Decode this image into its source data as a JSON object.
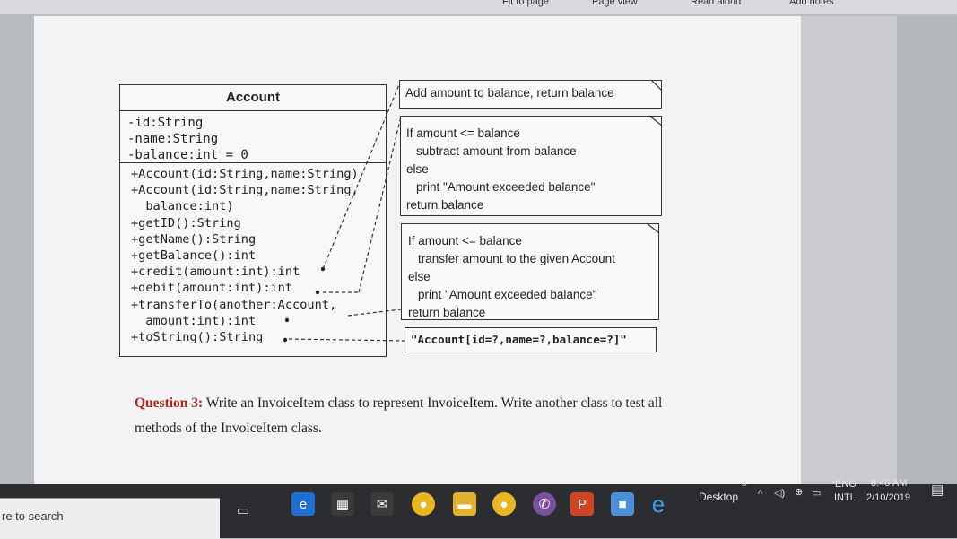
{
  "ribbon": {
    "item1": "Fit to page",
    "item2": "Page view",
    "item3": "Read aloud",
    "item4": "Add notes"
  },
  "uml": {
    "class_name": "Account",
    "attributes": [
      "-id:String",
      "-name:String",
      "-balance:int = 0"
    ],
    "operations": [
      "+Account(id:String,name:String)",
      "+Account(id:String,name:String,",
      "  balance:int)",
      "+getID():String",
      "+getName():String",
      "+getBalance():int",
      "+credit(amount:int):int",
      "+debit(amount:int):int",
      "+transferTo(another:Account,",
      "  amount:int):int",
      "+toString():String"
    ]
  },
  "notes": {
    "credit": "Add amount to balance, return balance",
    "debit": [
      "If amount <= balance",
      "subtract amount from balance",
      "else",
      "print \"Amount exceeded balance\"",
      "return balance"
    ],
    "transfer": [
      "If amount <= balance",
      "transfer amount to the given Account",
      "else",
      "print \"Amount exceeded balance\"",
      "return balance"
    ],
    "tostring": "\"Account[id=?,name=?,balance=?]\""
  },
  "question": {
    "label": "Question 3:",
    "text": "Write an InvoiceItem class to represent InvoiceItem. Write another class to test all methods of the InvoiceItem class."
  },
  "taskbar": {
    "search_placeholder": "re to search",
    "desktop_label": "Desktop",
    "language_top": "ENG",
    "language_bottom": "INTL",
    "time": "8:45 AM",
    "date": "2/10/2019",
    "icons": [
      "task-view-icon",
      "edge-icon",
      "store-icon",
      "mail-icon",
      "chrome-icon",
      "file-explorer-icon",
      "chrome-icon",
      "viber-icon",
      "powerpoint-icon",
      "box-icon",
      "internet-explorer-icon"
    ]
  }
}
